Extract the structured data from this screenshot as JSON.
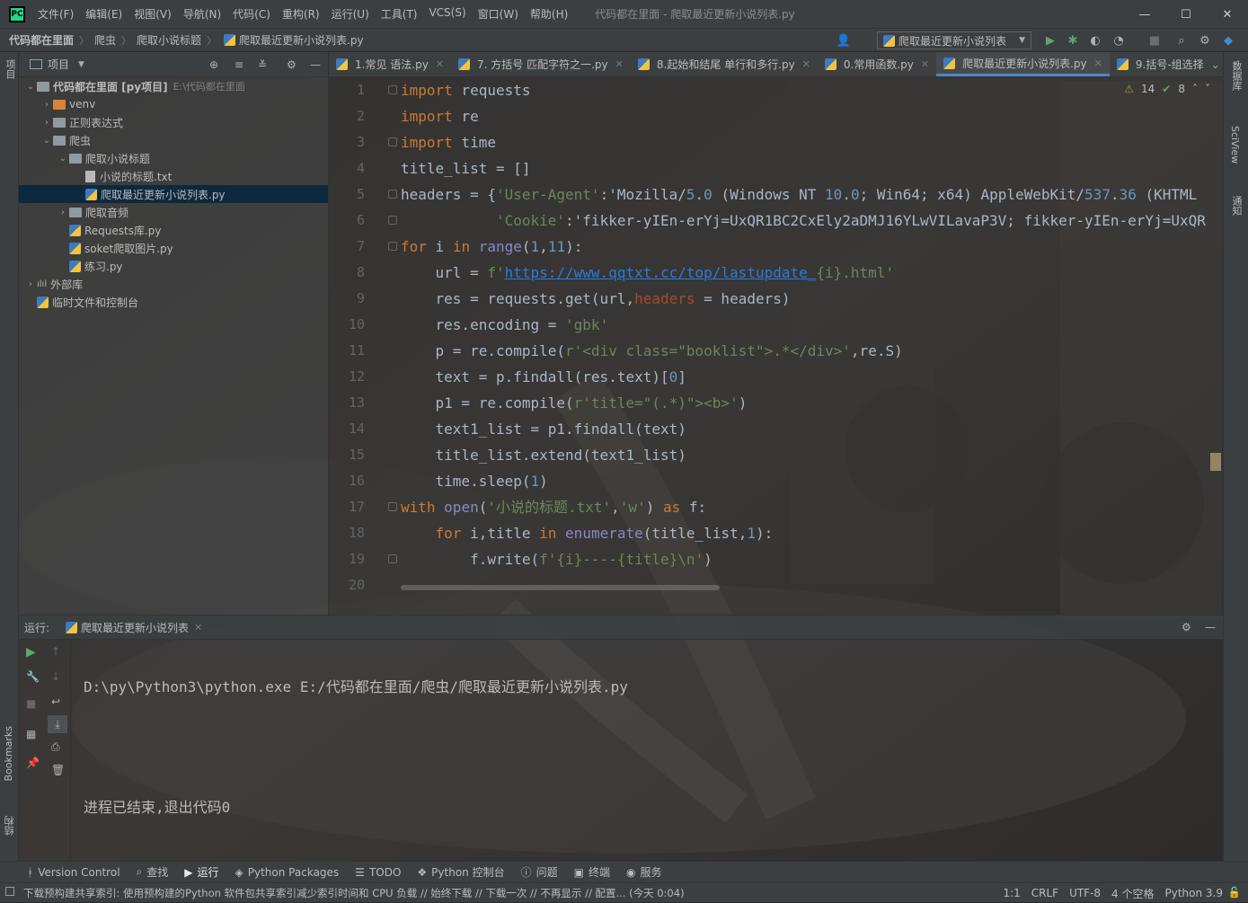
{
  "app": {
    "logo_text": "PC",
    "window_title": "代码都在里面 - 爬取最近更新小说列表.py",
    "menu": [
      "文件(F)",
      "编辑(E)",
      "视图(V)",
      "导航(N)",
      "代码(C)",
      "重构(R)",
      "运行(U)",
      "工具(T)",
      "VCS(S)",
      "窗口(W)",
      "帮助(H)"
    ]
  },
  "breadcrumb": [
    "代码都在里面",
    "爬虫",
    "爬取小说标题",
    "爬取最近更新小说列表.py"
  ],
  "run_config": "爬取最近更新小说列表",
  "left_tool_labels": {
    "project": "项目",
    "bookmarks": "Bookmarks",
    "structure": "结构"
  },
  "right_tool_labels": {
    "database": "数据库",
    "sciview": "SciView",
    "notifications": "通知"
  },
  "project_panel": {
    "title": "项目",
    "tree": [
      {
        "label": "代码都在里面 [py项目]",
        "hint": "E:\\代码都在里面",
        "type": "folder",
        "depth": 0,
        "expanded": true
      },
      {
        "label": "venv",
        "type": "folder-orange",
        "depth": 1,
        "expanded": false
      },
      {
        "label": "正则表达式",
        "type": "folder",
        "depth": 1,
        "expanded": false
      },
      {
        "label": "爬虫",
        "type": "folder",
        "depth": 1,
        "expanded": true
      },
      {
        "label": "爬取小说标题",
        "type": "folder",
        "depth": 2,
        "expanded": true
      },
      {
        "label": "小说的标题.txt",
        "type": "txt",
        "depth": 3
      },
      {
        "label": "爬取最近更新小说列表.py",
        "type": "py",
        "depth": 3,
        "selected": true
      },
      {
        "label": "爬取音频",
        "type": "folder",
        "depth": 2,
        "expanded": false
      },
      {
        "label": "Requests库.py",
        "type": "py",
        "depth": 2
      },
      {
        "label": "soket爬取图片.py",
        "type": "py",
        "depth": 2
      },
      {
        "label": "练习.py",
        "type": "py",
        "depth": 2
      },
      {
        "label": "外部库",
        "type": "lib",
        "depth": 0,
        "expanded": false
      },
      {
        "label": "临时文件和控制台",
        "type": "scratch",
        "depth": 0
      }
    ]
  },
  "tabs": [
    {
      "label": "1.常见 语法.py",
      "active": false
    },
    {
      "label": "7. 方括号 匹配字符之一.py",
      "active": false
    },
    {
      "label": "8.起始和结尾 单行和多行.py",
      "active": false
    },
    {
      "label": "0.常用函数.py",
      "active": false
    },
    {
      "label": "爬取最近更新小说列表.py",
      "active": true
    },
    {
      "label": "9.括号-组选择",
      "active": false
    }
  ],
  "inspections": {
    "warnings": "14",
    "ok": "8"
  },
  "line_numbers": [
    "1",
    "2",
    "3",
    "4",
    "5",
    "6",
    "7",
    "8",
    "9",
    "10",
    "11",
    "12",
    "13",
    "14",
    "15",
    "16",
    "17",
    "18",
    "19",
    "20"
  ],
  "code_lines": [
    "import requests",
    "import re",
    "import time",
    "title_list = []",
    "headers = {'User-Agent':'Mozilla/5.0 (Windows NT 10.0; Win64; x64) AppleWebKit/537.36 (KHTML",
    "           'Cookie':'fikker-yIEn-erYj=UxQR1BC2CxEly2aDMJ16YLwVILavaP3V; fikker-yIEn-erYj=UxQR",
    "for i in range(1,11):",
    "    url = f'https://www.qqtxt.cc/top/lastupdate_{i}.html'",
    "    res = requests.get(url,headers = headers)",
    "    res.encoding = 'gbk'",
    "    p = re.compile(r'<div class=\"booklist\">.*</div>',re.S)",
    "    text = p.findall(res.text)[0]",
    "    p1 = re.compile(r'title=\"(.*)\"><b>')",
    "    text1_list = p1.findall(text)",
    "    title_list.extend(text1_list)",
    "    time.sleep(1)",
    "with open('小说的标题.txt','w') as f:",
    "    for i,title in enumerate(title_list,1):",
    "        f.write(f'{i}----{title}\\n')",
    ""
  ],
  "run_panel": {
    "label": "运行:",
    "tab": "爬取最近更新小说列表",
    "console": [
      "D:\\py\\Python3\\python.exe E:/代码都在里面/爬虫/爬取最近更新小说列表.py",
      "",
      "进程已结束,退出代码0"
    ]
  },
  "bottom_tools": [
    {
      "label": "Version Control",
      "icon": "branch-icon"
    },
    {
      "label": "查找",
      "icon": "search-icon"
    },
    {
      "label": "运行",
      "icon": "play-icon",
      "active": true
    },
    {
      "label": "Python Packages",
      "icon": "layers-icon"
    },
    {
      "label": "TODO",
      "icon": "list-icon"
    },
    {
      "label": "Python 控制台",
      "icon": "python-icon"
    },
    {
      "label": "问题",
      "icon": "info-icon"
    },
    {
      "label": "终端",
      "icon": "terminal-icon"
    },
    {
      "label": "服务",
      "icon": "services-icon"
    }
  ],
  "status": {
    "message": "下载预构建共享索引: 使用预构建的Python 软件包共享索引减少索引时间和 CPU 负载 // 始终下载 // 下载一次 // 不再显示 // 配置... (今天 0:04)",
    "position": "1:1",
    "line_sep": "CRLF",
    "encoding": "UTF-8",
    "indent": "4 个空格",
    "interpreter": "Python 3.9"
  }
}
